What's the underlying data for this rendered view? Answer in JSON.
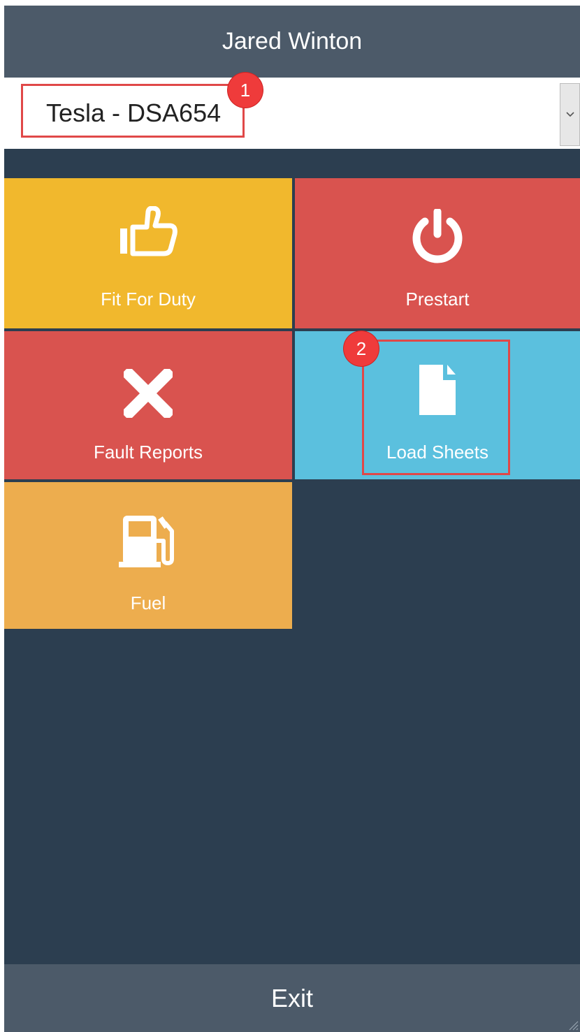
{
  "header": {
    "user_name": "Jared Winton"
  },
  "vehicle_select": {
    "selected_value": "Tesla - DSA654",
    "icon": "chevron-down-icon"
  },
  "annotations": [
    {
      "number": "1",
      "target": "vehicle-select"
    },
    {
      "number": "2",
      "target": "tile-load-sheets"
    }
  ],
  "tiles": [
    {
      "label": "Fit For Duty",
      "icon": "thumbs-up-icon",
      "color": "#f1b82d"
    },
    {
      "label": "Prestart",
      "icon": "power-icon",
      "color": "#d9534f"
    },
    {
      "label": "Fault Reports",
      "icon": "close-icon",
      "color": "#d9534f"
    },
    {
      "label": "Load Sheets",
      "icon": "document-icon",
      "color": "#5bc0de"
    },
    {
      "label": "Fuel",
      "icon": "fuel-pump-icon",
      "color": "#edad4e"
    }
  ],
  "footer": {
    "exit_label": "Exit"
  },
  "colors": {
    "background": "#2c3e50",
    "header": "#4c5a69",
    "annotation": "#e04848"
  }
}
